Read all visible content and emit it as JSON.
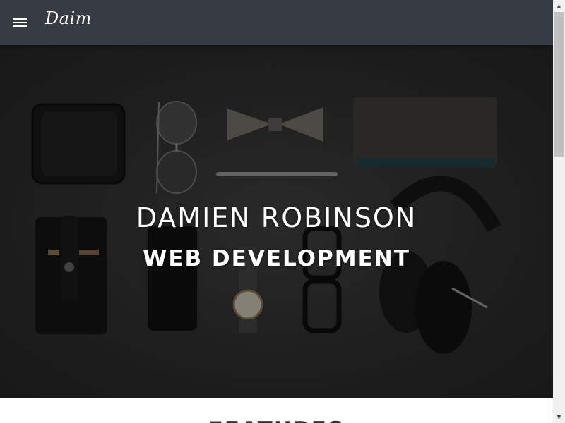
{
  "navbar": {
    "menu_icon": "hamburger-menu-icon",
    "brand": "Daim"
  },
  "hero": {
    "title": "DAMIEN ROBINSON",
    "subtitle": "WEB DEVELOPMENT"
  },
  "features": {
    "title": "FEATURES"
  },
  "scrollbar": {
    "up_icon": "scroll-up-arrow-icon",
    "down_icon": "scroll-down-arrow-icon",
    "position": 0
  },
  "colors": {
    "navbar_bg": "#373b44",
    "hero_bg": "#2b2b2b",
    "text_light": "#ffffff",
    "text_dark": "#333333"
  }
}
